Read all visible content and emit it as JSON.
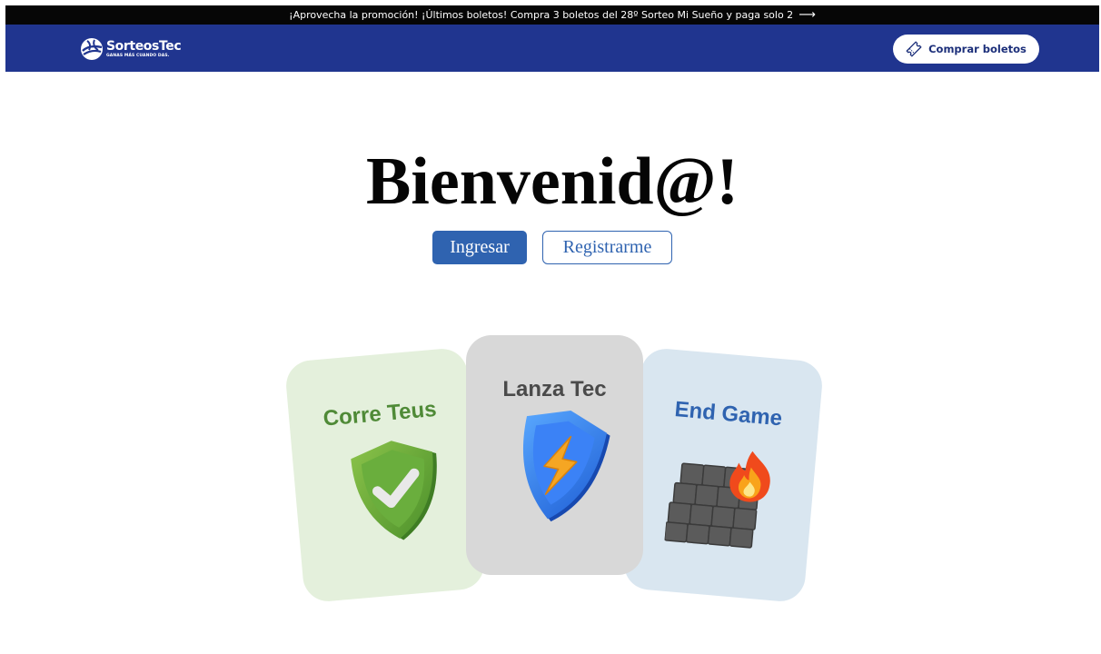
{
  "promo": {
    "text": "¡Aprovecha la promoción! ¡Últimos boletos! Compra 3 boletos del 28º Sorteo Mi Sueño y paga solo 2",
    "arrow": "⟶"
  },
  "nav": {
    "logo_name": "SorteosTec",
    "logo_tagline": "GANAS MÁS CUANDO DAS.",
    "buy_label": "Comprar boletos",
    "buy_icon": "ticket-icon"
  },
  "hero": {
    "title": "Bienvenid@!",
    "login_label": "Ingresar",
    "register_label": "Registrarme"
  },
  "games": [
    {
      "title": "Corre Teus",
      "icon": "shield-check-icon"
    },
    {
      "title": "Lanza Tec",
      "icon": "shield-lightning-icon"
    },
    {
      "title": "End Game",
      "icon": "firewall-icon"
    }
  ],
  "colors": {
    "nav_bg": "#20358f",
    "promo_bg": "#060606",
    "primary": "#2f63b0",
    "card_green": "#e4f0dc",
    "card_gray": "#d8d8d8",
    "card_blue": "#d9e6f0"
  }
}
